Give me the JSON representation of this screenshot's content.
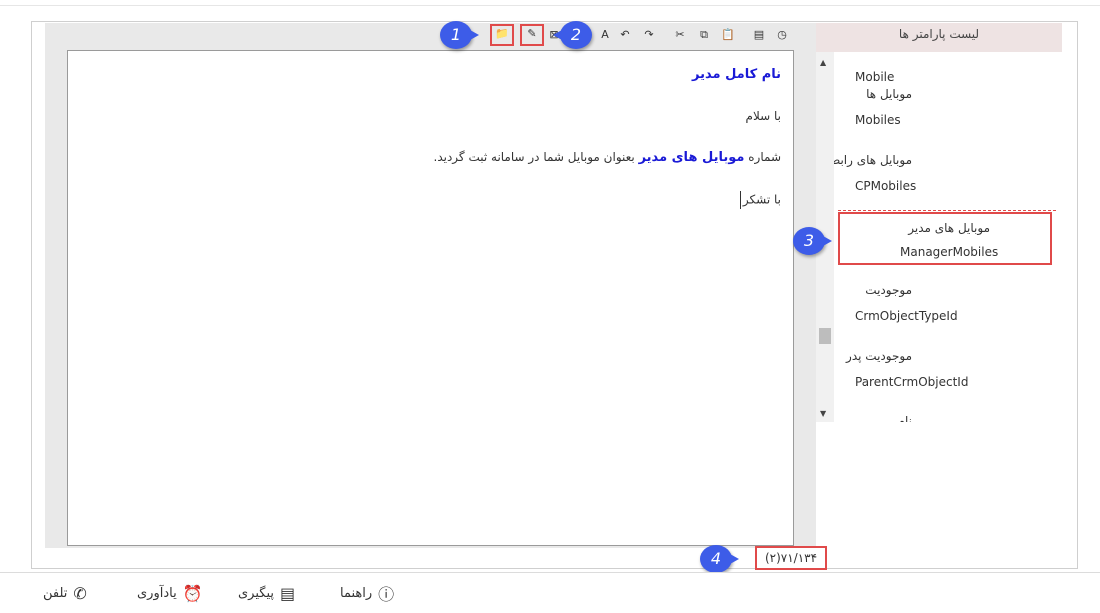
{
  "toolbar": {
    "icons": [
      "open-folder-icon",
      "edit-template-icon",
      "find-replace-icon",
      "spellcheck-icon",
      "undo-icon",
      "redo-icon",
      "cut-icon",
      "copy-icon",
      "paste-icon",
      "insert-field-icon",
      "insert-time-icon"
    ],
    "glyphs": {
      "folder": "📁",
      "edit": "✎",
      "find": "⊠",
      "spell": "A",
      "undo": "↶",
      "redo": "↷",
      "cut": "✂",
      "copy": "⧉",
      "paste": "📋",
      "field": "▤",
      "time": "◷"
    }
  },
  "editor": {
    "title": "نام کامل مدیر",
    "greeting": "با سلام",
    "body_prefix": "شماره",
    "body_bold": "موبایل های مدیر",
    "body_suffix": "بعنوان موبایل شما در سامانه ثبت گردید.",
    "closing": "با تشکر"
  },
  "params_panel": {
    "header": "لیست پارامتر ها",
    "items": [
      {
        "fa": "",
        "en": "Mobile"
      },
      {
        "fa": "موبایل ها",
        "en": "Mobiles"
      },
      {
        "fa": "موبایل های رابط",
        "en": "CPMobiles"
      },
      {
        "fa": "موبایل های مدیر",
        "en": "ManagerMobiles"
      },
      {
        "fa": "موجودیت",
        "en": "CrmObjectTypeId"
      },
      {
        "fa": "موجودیت پدر",
        "en": "ParentCrmObjectId"
      },
      {
        "fa": "نام",
        "en": ""
      }
    ],
    "selected_index": 3
  },
  "counter": "(۲)۷۱/۱۳۴",
  "badges": [
    "1",
    "2",
    "3",
    "4"
  ],
  "bottom_bar": {
    "help": "راهنما",
    "followup": "پیگیری",
    "reminder": "یادآوری",
    "phone": "تلفن"
  },
  "colors": {
    "accent_badge": "#3d5ce8",
    "highlight": "#e04a4a",
    "link_blue": "#1a1ad6"
  }
}
